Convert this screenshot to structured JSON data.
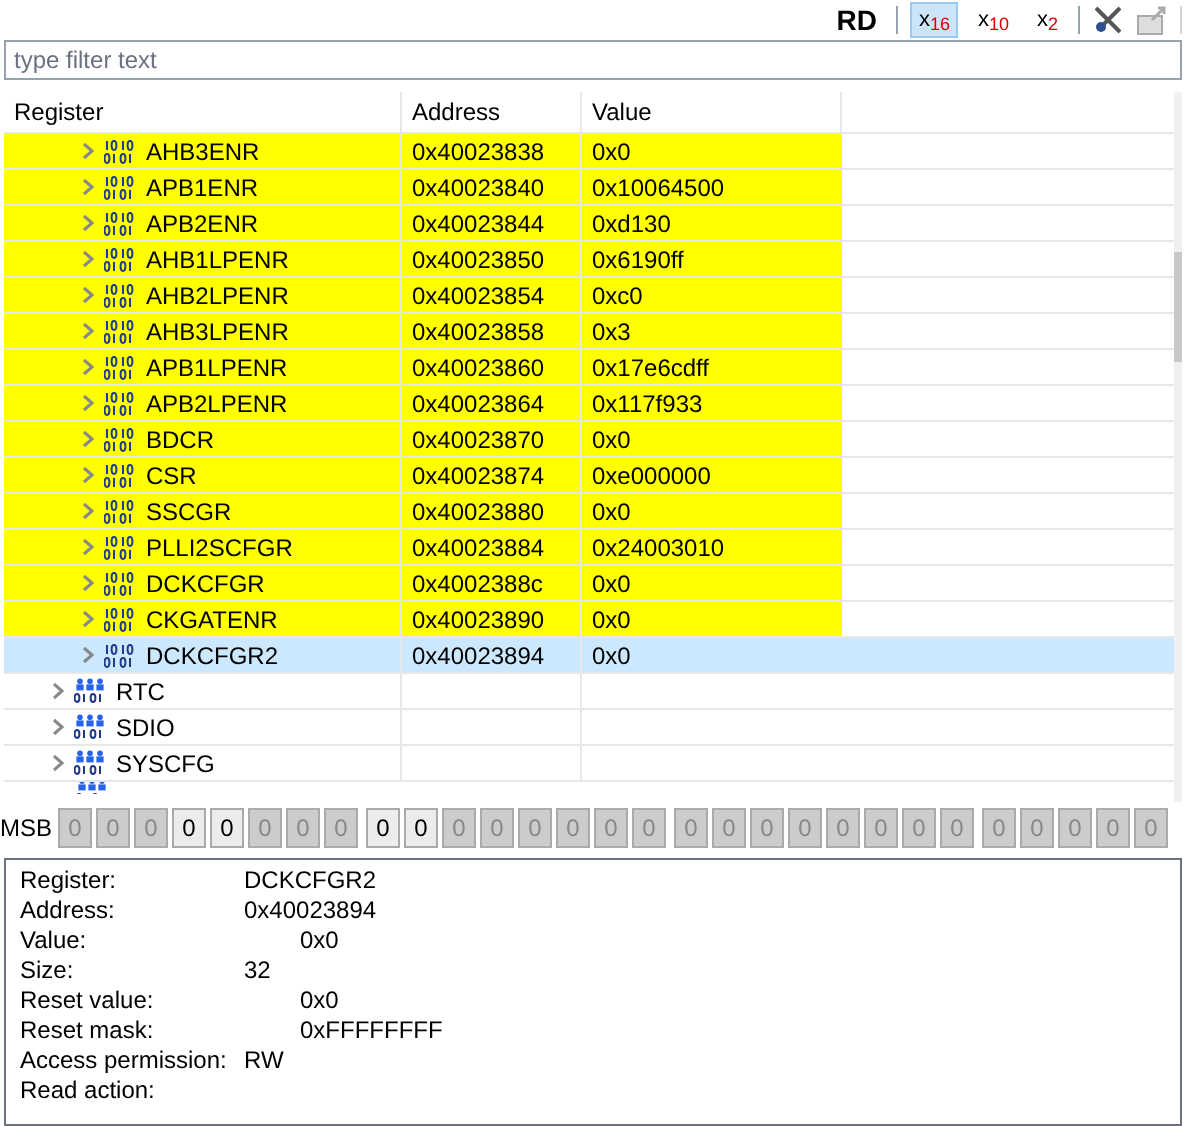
{
  "toolbar": {
    "read_label": "RD",
    "formats": [
      {
        "label": "x",
        "sub": "16",
        "selected": true
      },
      {
        "label": "x",
        "sub": "10",
        "selected": false
      },
      {
        "label": "x",
        "sub": "2",
        "selected": false
      }
    ]
  },
  "filter": {
    "placeholder": "type filter text"
  },
  "table": {
    "columns": [
      "Register",
      "Address",
      "Value"
    ],
    "rows": [
      {
        "kind": "register",
        "name": "AHB3ENR",
        "address": "0x40023838",
        "value": "0x0",
        "highlighted": true,
        "selected": false
      },
      {
        "kind": "register",
        "name": "APB1ENR",
        "address": "0x40023840",
        "value": "0x10064500",
        "highlighted": true,
        "selected": false
      },
      {
        "kind": "register",
        "name": "APB2ENR",
        "address": "0x40023844",
        "value": "0xd130",
        "highlighted": true,
        "selected": false
      },
      {
        "kind": "register",
        "name": "AHB1LPENR",
        "address": "0x40023850",
        "value": "0x6190ff",
        "highlighted": true,
        "selected": false
      },
      {
        "kind": "register",
        "name": "AHB2LPENR",
        "address": "0x40023854",
        "value": "0xc0",
        "highlighted": true,
        "selected": false
      },
      {
        "kind": "register",
        "name": "AHB3LPENR",
        "address": "0x40023858",
        "value": "0x3",
        "highlighted": true,
        "selected": false
      },
      {
        "kind": "register",
        "name": "APB1LPENR",
        "address": "0x40023860",
        "value": "0x17e6cdff",
        "highlighted": true,
        "selected": false
      },
      {
        "kind": "register",
        "name": "APB2LPENR",
        "address": "0x40023864",
        "value": "0x117f933",
        "highlighted": true,
        "selected": false
      },
      {
        "kind": "register",
        "name": "BDCR",
        "address": "0x40023870",
        "value": "0x0",
        "highlighted": true,
        "selected": false
      },
      {
        "kind": "register",
        "name": "CSR",
        "address": "0x40023874",
        "value": "0xe000000",
        "highlighted": true,
        "selected": false
      },
      {
        "kind": "register",
        "name": "SSCGR",
        "address": "0x40023880",
        "value": "0x0",
        "highlighted": true,
        "selected": false
      },
      {
        "kind": "register",
        "name": "PLLI2SCFGR",
        "address": "0x40023884",
        "value": "0x24003010",
        "highlighted": true,
        "selected": false
      },
      {
        "kind": "register",
        "name": "DCKCFGR",
        "address": "0x4002388c",
        "value": "0x0",
        "highlighted": true,
        "selected": false
      },
      {
        "kind": "register",
        "name": "CKGATENR",
        "address": "0x40023890",
        "value": "0x0",
        "highlighted": true,
        "selected": false
      },
      {
        "kind": "register",
        "name": "DCKCFGR2",
        "address": "0x40023894",
        "value": "0x0",
        "highlighted": false,
        "selected": true
      },
      {
        "kind": "peripheral",
        "name": "RTC",
        "highlighted": false,
        "selected": false
      },
      {
        "kind": "peripheral",
        "name": "SDIO",
        "highlighted": false,
        "selected": false
      },
      {
        "kind": "peripheral",
        "name": "SYSCFG",
        "highlighted": false,
        "selected": false
      }
    ]
  },
  "bits": {
    "label": "MSB",
    "values": [
      {
        "text": "0",
        "enabled": false
      },
      {
        "text": "0",
        "enabled": false
      },
      {
        "text": "0",
        "enabled": false
      },
      {
        "text": "0",
        "enabled": true
      },
      {
        "text": "0",
        "enabled": true
      },
      {
        "text": "0",
        "enabled": false
      },
      {
        "text": "0",
        "enabled": false
      },
      {
        "text": "0",
        "enabled": false
      },
      {
        "text": "0",
        "enabled": true
      },
      {
        "text": "0",
        "enabled": true
      },
      {
        "text": "0",
        "enabled": false
      },
      {
        "text": "0",
        "enabled": false
      },
      {
        "text": "0",
        "enabled": false
      },
      {
        "text": "0",
        "enabled": false
      },
      {
        "text": "0",
        "enabled": false
      },
      {
        "text": "0",
        "enabled": false
      },
      {
        "text": "0",
        "enabled": false
      },
      {
        "text": "0",
        "enabled": false
      },
      {
        "text": "0",
        "enabled": false
      },
      {
        "text": "0",
        "enabled": false
      },
      {
        "text": "0",
        "enabled": false
      },
      {
        "text": "0",
        "enabled": false
      },
      {
        "text": "0",
        "enabled": false
      },
      {
        "text": "0",
        "enabled": false
      },
      {
        "text": "0",
        "enabled": false
      },
      {
        "text": "0",
        "enabled": false
      },
      {
        "text": "0",
        "enabled": false
      },
      {
        "text": "0",
        "enabled": false
      },
      {
        "text": "0",
        "enabled": false
      }
    ]
  },
  "details": [
    {
      "label": "Register:",
      "value": "DCKCFGR2",
      "kind": "text"
    },
    {
      "label": "Address:",
      "value": "0x40023894",
      "kind": "text"
    },
    {
      "label": "Value:",
      "value": "0x0",
      "kind": "number"
    },
    {
      "label": "Size:",
      "value": "32",
      "kind": "text"
    },
    {
      "label": "Reset value:",
      "value": "0x0",
      "kind": "number"
    },
    {
      "label": "Reset mask:",
      "value": "0xFFFFFFFF",
      "kind": "number"
    },
    {
      "label": "Access permission:",
      "value": "RW",
      "kind": "text"
    },
    {
      "label": "Read action:"
    }
  ]
}
